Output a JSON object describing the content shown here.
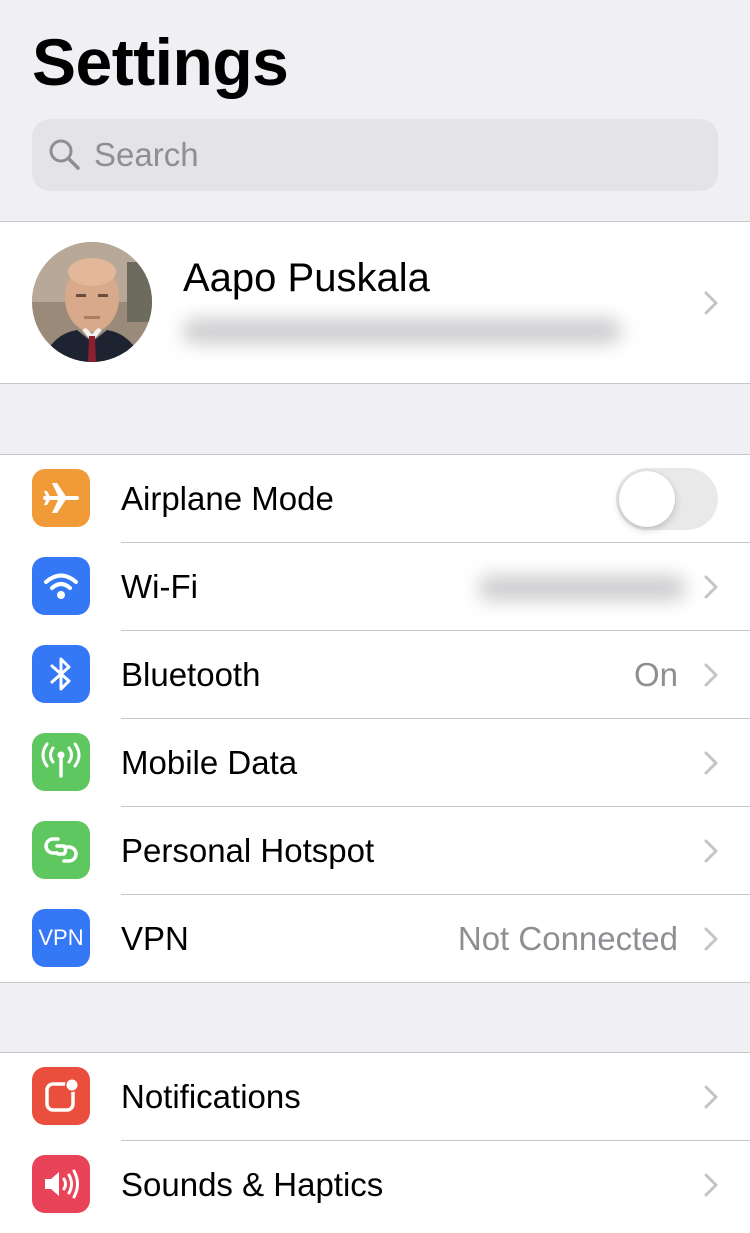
{
  "header": {
    "title": "Settings"
  },
  "search": {
    "placeholder": "Search",
    "icon": "magnifier-icon"
  },
  "profile": {
    "name": "Aapo Puskala"
  },
  "colors": {
    "orange": "#f19a38",
    "blue": "#3478f6",
    "green": "#5fc75f",
    "red": "#ea4e3d",
    "pink": "#e9435a"
  },
  "group1": {
    "items": [
      {
        "label": "Airplane Mode",
        "icon": "airplane-icon",
        "toggle": false
      },
      {
        "label": "Wi-Fi",
        "icon": "wifi-icon",
        "value": ""
      },
      {
        "label": "Bluetooth",
        "icon": "bluetooth-icon",
        "value": "On"
      },
      {
        "label": "Mobile Data",
        "icon": "antenna-icon",
        "value": ""
      },
      {
        "label": "Personal Hotspot",
        "icon": "hotspot-icon",
        "value": ""
      },
      {
        "label": "VPN",
        "icon": "vpn-icon",
        "icon_text": "VPN",
        "value": "Not Connected"
      }
    ]
  },
  "group2": {
    "items": [
      {
        "label": "Notifications",
        "icon": "notifications-icon"
      },
      {
        "label": "Sounds & Haptics",
        "icon": "speaker-icon"
      }
    ]
  }
}
